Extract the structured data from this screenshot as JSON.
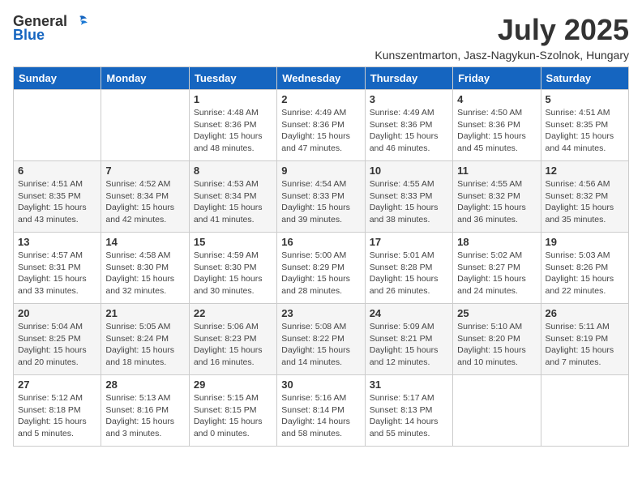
{
  "header": {
    "logo_general": "General",
    "logo_blue": "Blue",
    "month": "July 2025",
    "location": "Kunszentmarton, Jasz-Nagykun-Szolnok, Hungary"
  },
  "days_of_week": [
    "Sunday",
    "Monday",
    "Tuesday",
    "Wednesday",
    "Thursday",
    "Friday",
    "Saturday"
  ],
  "weeks": [
    [
      {
        "day": "",
        "sunrise": "",
        "sunset": "",
        "daylight": ""
      },
      {
        "day": "",
        "sunrise": "",
        "sunset": "",
        "daylight": ""
      },
      {
        "day": "1",
        "sunrise": "Sunrise: 4:48 AM",
        "sunset": "Sunset: 8:36 PM",
        "daylight": "Daylight: 15 hours and 48 minutes."
      },
      {
        "day": "2",
        "sunrise": "Sunrise: 4:49 AM",
        "sunset": "Sunset: 8:36 PM",
        "daylight": "Daylight: 15 hours and 47 minutes."
      },
      {
        "day": "3",
        "sunrise": "Sunrise: 4:49 AM",
        "sunset": "Sunset: 8:36 PM",
        "daylight": "Daylight: 15 hours and 46 minutes."
      },
      {
        "day": "4",
        "sunrise": "Sunrise: 4:50 AM",
        "sunset": "Sunset: 8:36 PM",
        "daylight": "Daylight: 15 hours and 45 minutes."
      },
      {
        "day": "5",
        "sunrise": "Sunrise: 4:51 AM",
        "sunset": "Sunset: 8:35 PM",
        "daylight": "Daylight: 15 hours and 44 minutes."
      }
    ],
    [
      {
        "day": "6",
        "sunrise": "Sunrise: 4:51 AM",
        "sunset": "Sunset: 8:35 PM",
        "daylight": "Daylight: 15 hours and 43 minutes."
      },
      {
        "day": "7",
        "sunrise": "Sunrise: 4:52 AM",
        "sunset": "Sunset: 8:34 PM",
        "daylight": "Daylight: 15 hours and 42 minutes."
      },
      {
        "day": "8",
        "sunrise": "Sunrise: 4:53 AM",
        "sunset": "Sunset: 8:34 PM",
        "daylight": "Daylight: 15 hours and 41 minutes."
      },
      {
        "day": "9",
        "sunrise": "Sunrise: 4:54 AM",
        "sunset": "Sunset: 8:33 PM",
        "daylight": "Daylight: 15 hours and 39 minutes."
      },
      {
        "day": "10",
        "sunrise": "Sunrise: 4:55 AM",
        "sunset": "Sunset: 8:33 PM",
        "daylight": "Daylight: 15 hours and 38 minutes."
      },
      {
        "day": "11",
        "sunrise": "Sunrise: 4:55 AM",
        "sunset": "Sunset: 8:32 PM",
        "daylight": "Daylight: 15 hours and 36 minutes."
      },
      {
        "day": "12",
        "sunrise": "Sunrise: 4:56 AM",
        "sunset": "Sunset: 8:32 PM",
        "daylight": "Daylight: 15 hours and 35 minutes."
      }
    ],
    [
      {
        "day": "13",
        "sunrise": "Sunrise: 4:57 AM",
        "sunset": "Sunset: 8:31 PM",
        "daylight": "Daylight: 15 hours and 33 minutes."
      },
      {
        "day": "14",
        "sunrise": "Sunrise: 4:58 AM",
        "sunset": "Sunset: 8:30 PM",
        "daylight": "Daylight: 15 hours and 32 minutes."
      },
      {
        "day": "15",
        "sunrise": "Sunrise: 4:59 AM",
        "sunset": "Sunset: 8:30 PM",
        "daylight": "Daylight: 15 hours and 30 minutes."
      },
      {
        "day": "16",
        "sunrise": "Sunrise: 5:00 AM",
        "sunset": "Sunset: 8:29 PM",
        "daylight": "Daylight: 15 hours and 28 minutes."
      },
      {
        "day": "17",
        "sunrise": "Sunrise: 5:01 AM",
        "sunset": "Sunset: 8:28 PM",
        "daylight": "Daylight: 15 hours and 26 minutes."
      },
      {
        "day": "18",
        "sunrise": "Sunrise: 5:02 AM",
        "sunset": "Sunset: 8:27 PM",
        "daylight": "Daylight: 15 hours and 24 minutes."
      },
      {
        "day": "19",
        "sunrise": "Sunrise: 5:03 AM",
        "sunset": "Sunset: 8:26 PM",
        "daylight": "Daylight: 15 hours and 22 minutes."
      }
    ],
    [
      {
        "day": "20",
        "sunrise": "Sunrise: 5:04 AM",
        "sunset": "Sunset: 8:25 PM",
        "daylight": "Daylight: 15 hours and 20 minutes."
      },
      {
        "day": "21",
        "sunrise": "Sunrise: 5:05 AM",
        "sunset": "Sunset: 8:24 PM",
        "daylight": "Daylight: 15 hours and 18 minutes."
      },
      {
        "day": "22",
        "sunrise": "Sunrise: 5:06 AM",
        "sunset": "Sunset: 8:23 PM",
        "daylight": "Daylight: 15 hours and 16 minutes."
      },
      {
        "day": "23",
        "sunrise": "Sunrise: 5:08 AM",
        "sunset": "Sunset: 8:22 PM",
        "daylight": "Daylight: 15 hours and 14 minutes."
      },
      {
        "day": "24",
        "sunrise": "Sunrise: 5:09 AM",
        "sunset": "Sunset: 8:21 PM",
        "daylight": "Daylight: 15 hours and 12 minutes."
      },
      {
        "day": "25",
        "sunrise": "Sunrise: 5:10 AM",
        "sunset": "Sunset: 8:20 PM",
        "daylight": "Daylight: 15 hours and 10 minutes."
      },
      {
        "day": "26",
        "sunrise": "Sunrise: 5:11 AM",
        "sunset": "Sunset: 8:19 PM",
        "daylight": "Daylight: 15 hours and 7 minutes."
      }
    ],
    [
      {
        "day": "27",
        "sunrise": "Sunrise: 5:12 AM",
        "sunset": "Sunset: 8:18 PM",
        "daylight": "Daylight: 15 hours and 5 minutes."
      },
      {
        "day": "28",
        "sunrise": "Sunrise: 5:13 AM",
        "sunset": "Sunset: 8:16 PM",
        "daylight": "Daylight: 15 hours and 3 minutes."
      },
      {
        "day": "29",
        "sunrise": "Sunrise: 5:15 AM",
        "sunset": "Sunset: 8:15 PM",
        "daylight": "Daylight: 15 hours and 0 minutes."
      },
      {
        "day": "30",
        "sunrise": "Sunrise: 5:16 AM",
        "sunset": "Sunset: 8:14 PM",
        "daylight": "Daylight: 14 hours and 58 minutes."
      },
      {
        "day": "31",
        "sunrise": "Sunrise: 5:17 AM",
        "sunset": "Sunset: 8:13 PM",
        "daylight": "Daylight: 14 hours and 55 minutes."
      },
      {
        "day": "",
        "sunrise": "",
        "sunset": "",
        "daylight": ""
      },
      {
        "day": "",
        "sunrise": "",
        "sunset": "",
        "daylight": ""
      }
    ]
  ]
}
